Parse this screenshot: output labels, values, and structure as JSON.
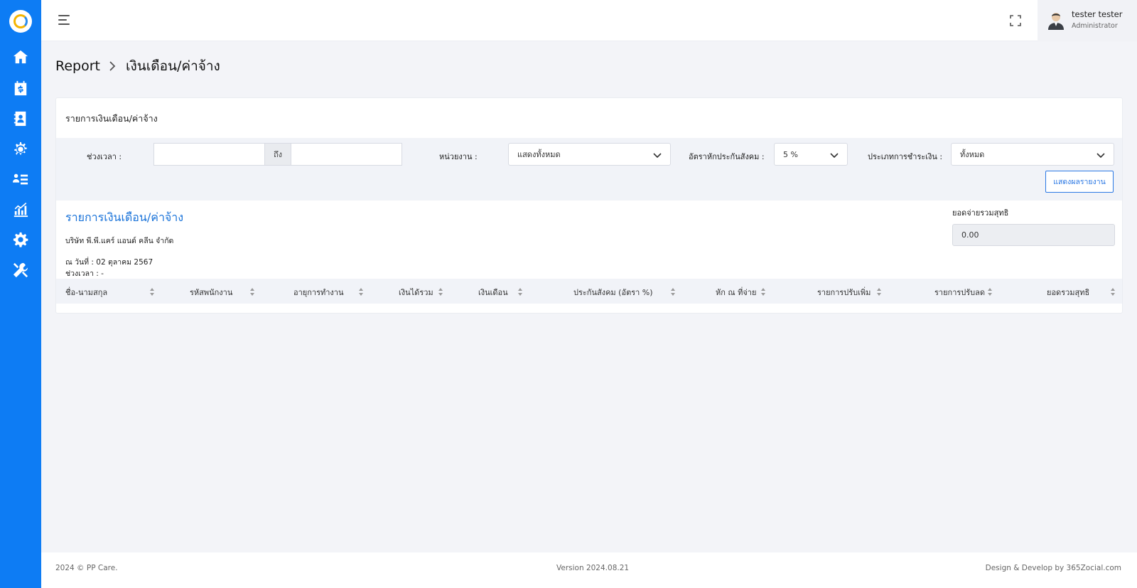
{
  "header": {
    "user_name": "tester tester",
    "user_role": "Administrator"
  },
  "sidebar": {
    "items": [
      {
        "icon": "home-icon"
      },
      {
        "icon": "calendar-dollar-icon"
      },
      {
        "icon": "contact-book-icon"
      },
      {
        "icon": "users-gear-icon"
      },
      {
        "icon": "user-list-icon"
      },
      {
        "icon": "chart-icon"
      },
      {
        "icon": "gear-icon"
      },
      {
        "icon": "tools-icon"
      }
    ]
  },
  "breadcrumb": {
    "parent": "Report",
    "current": "เงินเดือน/ค่าจ้าง"
  },
  "card": {
    "title": "รายการเงินเดือน/ค่าจ้าง",
    "filter": {
      "period_label": "ช่วงเวลา :",
      "period_from_value": "",
      "period_to_addon": "ถึง",
      "period_to_value": "",
      "unit_label": "หน่วยงาน :",
      "unit_value": "แสดงทั้งหมด",
      "ss_rate_label": "อัตราหักประกันสังคม :",
      "ss_rate_value": "5 %",
      "pay_type_label": "ประเภทการชำระเงิน :",
      "pay_type_value": "ทั้งหมด",
      "show_button": "แสดงผลรายงาน"
    },
    "report": {
      "title": "รายการเงินเดือน/ค่าจ้าง",
      "company": "บริษัท พี.พี.แคร์ แอนด์ คลีน จำกัด",
      "as_of": "ณ วันที่ : 02 ตุลาคม 2567",
      "period": "ช่วงเวลา : -",
      "net_label": "ยอดจ่ายรวมสุทธิ",
      "net_value": "0.00"
    },
    "table": {
      "columns": [
        "ชื่อ-นามสกุล",
        "รหัสพนักงาน",
        "อายุการทำงาน",
        "เงินได้รวม",
        "เงินเดือน",
        "ประกันสังคม (อัตรา %)",
        "หัก ณ ที่จ่าย",
        "รายการปรับเพิ่ม",
        "รายการปรับลด",
        "ยอดรวมสุทธิ"
      ],
      "rows": []
    }
  },
  "footer": {
    "left": "2024 © PP Care.",
    "center": "Version 2024.08.21",
    "right": "Design & Develop by 365Zocial.com"
  },
  "colors": {
    "sidebar": "#0d7cf4",
    "accent": "#1a73d9"
  }
}
